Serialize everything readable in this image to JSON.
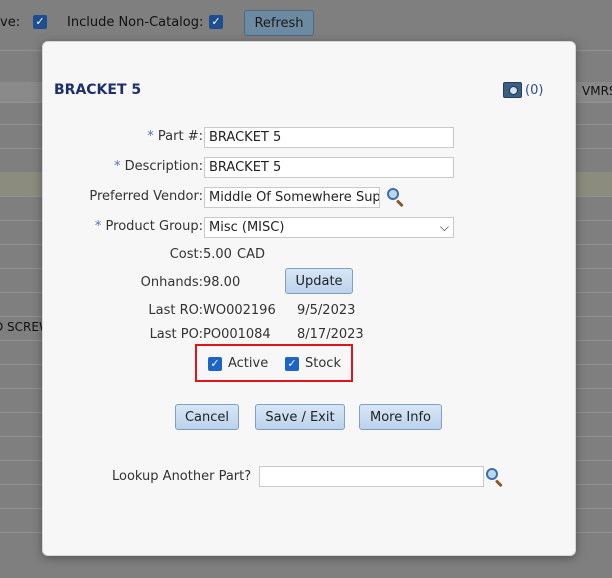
{
  "background": {
    "active_label_fragment": "ve:",
    "include_noncatalog_label": "Include Non-Catalog:",
    "refresh_label": "Refresh",
    "vmrs_fragment": "VMRS",
    "row_fragment": "D SCREW"
  },
  "modal": {
    "title": "BRACKET 5",
    "photo_count": "(0)",
    "part_label": "Part #:",
    "part_value": "BRACKET 5",
    "description_label": "Description:",
    "description_value": "BRACKET 5",
    "preferred_vendor_label": "Preferred Vendor:",
    "preferred_vendor_value": "Middle Of Somewhere Supp",
    "product_group_label": "Product Group:",
    "product_group_value": "Misc (MISC)",
    "cost_label": "Cost:",
    "cost_value": "5.00",
    "cost_currency": "CAD",
    "onhands_label": "Onhands:",
    "onhands_value": "98.00",
    "update_label": "Update",
    "last_ro_label": "Last RO:",
    "last_ro_number": "WO002196",
    "last_ro_date": "9/5/2023",
    "last_po_label": "Last PO:",
    "last_po_number": "PO001084",
    "last_po_date": "8/17/2023",
    "active_label": "Active",
    "stock_label": "Stock",
    "cancel_label": "Cancel",
    "save_exit_label": "Save / Exit",
    "more_info_label": "More Info",
    "lookup_label": "Lookup Another Part?",
    "lookup_value": ""
  },
  "colors": {
    "title": "#1f2f6b",
    "required_asterisk": "#4a74b4",
    "highlight_frame": "#e0151b",
    "checkbox": "#1d64c6"
  }
}
